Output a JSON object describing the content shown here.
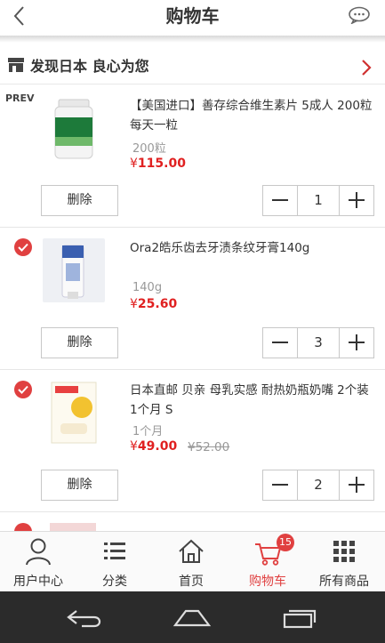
{
  "header": {
    "title": "购物车"
  },
  "store": {
    "name": "发现日本 良心为您"
  },
  "items": [
    {
      "badge": "PREV",
      "title": "【美国进口】善存综合维生素片 5成人 200粒 每天一粒",
      "spec": "200粒",
      "price_symbol": "¥",
      "price": "115.00",
      "old_price": "",
      "delete_label": "删除",
      "quantity": "1"
    },
    {
      "badge": "",
      "title": "Ora2皓乐齿去牙渍条纹牙膏140g",
      "spec": "140g",
      "price_symbol": "¥",
      "price": "25.60",
      "old_price": "",
      "delete_label": "删除",
      "quantity": "3"
    },
    {
      "badge": "",
      "title": "日本直邮 贝亲 母乳实感 耐热奶瓶奶嘴 2个装 1个月 S",
      "spec": "1个月",
      "price_symbol": "¥",
      "price": "49.00",
      "old_price": "¥52.00",
      "delete_label": "删除",
      "quantity": "2"
    }
  ],
  "tabbar": {
    "tabs": [
      {
        "label": "用户中心",
        "icon": "user-icon"
      },
      {
        "label": "分类",
        "icon": "list-icon"
      },
      {
        "label": "首页",
        "icon": "home-icon"
      },
      {
        "label": "购物车",
        "icon": "cart-icon",
        "badge": "15",
        "active": true
      },
      {
        "label": "所有商品",
        "icon": "grid-icon"
      }
    ]
  },
  "colors": {
    "accent": "#e04040",
    "price": "#e02020",
    "sysnav": "#2b2b2b"
  }
}
